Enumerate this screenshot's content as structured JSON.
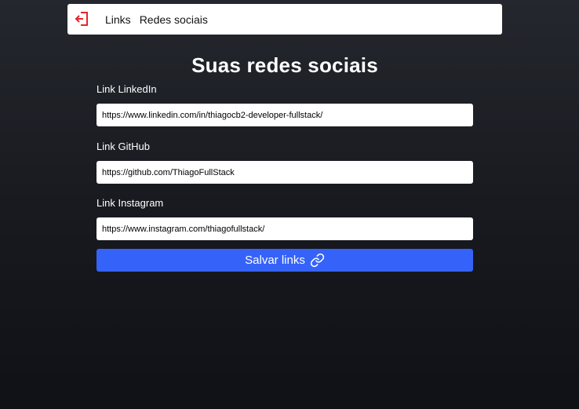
{
  "header": {
    "logout_icon": "logout-icon",
    "nav": [
      {
        "label": "Links"
      },
      {
        "label": "Redes sociais"
      }
    ]
  },
  "page": {
    "title": "Suas redes sociais"
  },
  "form": {
    "linkedin": {
      "label": "Link LinkedIn",
      "value": "https://www.linkedin.com/in/thiagocb2-developer-fullstack/"
    },
    "github": {
      "label": "Link GitHub",
      "value": "https://github.com/ThiagoFullStack"
    },
    "instagram": {
      "label": "Link Instagram",
      "value": "https://www.instagram.com/thiagofullstack/"
    },
    "save_button": {
      "label": "Salvar links",
      "icon": "link-icon"
    }
  },
  "colors": {
    "accent": "#3563f9",
    "logout_icon": "#e5262b"
  }
}
